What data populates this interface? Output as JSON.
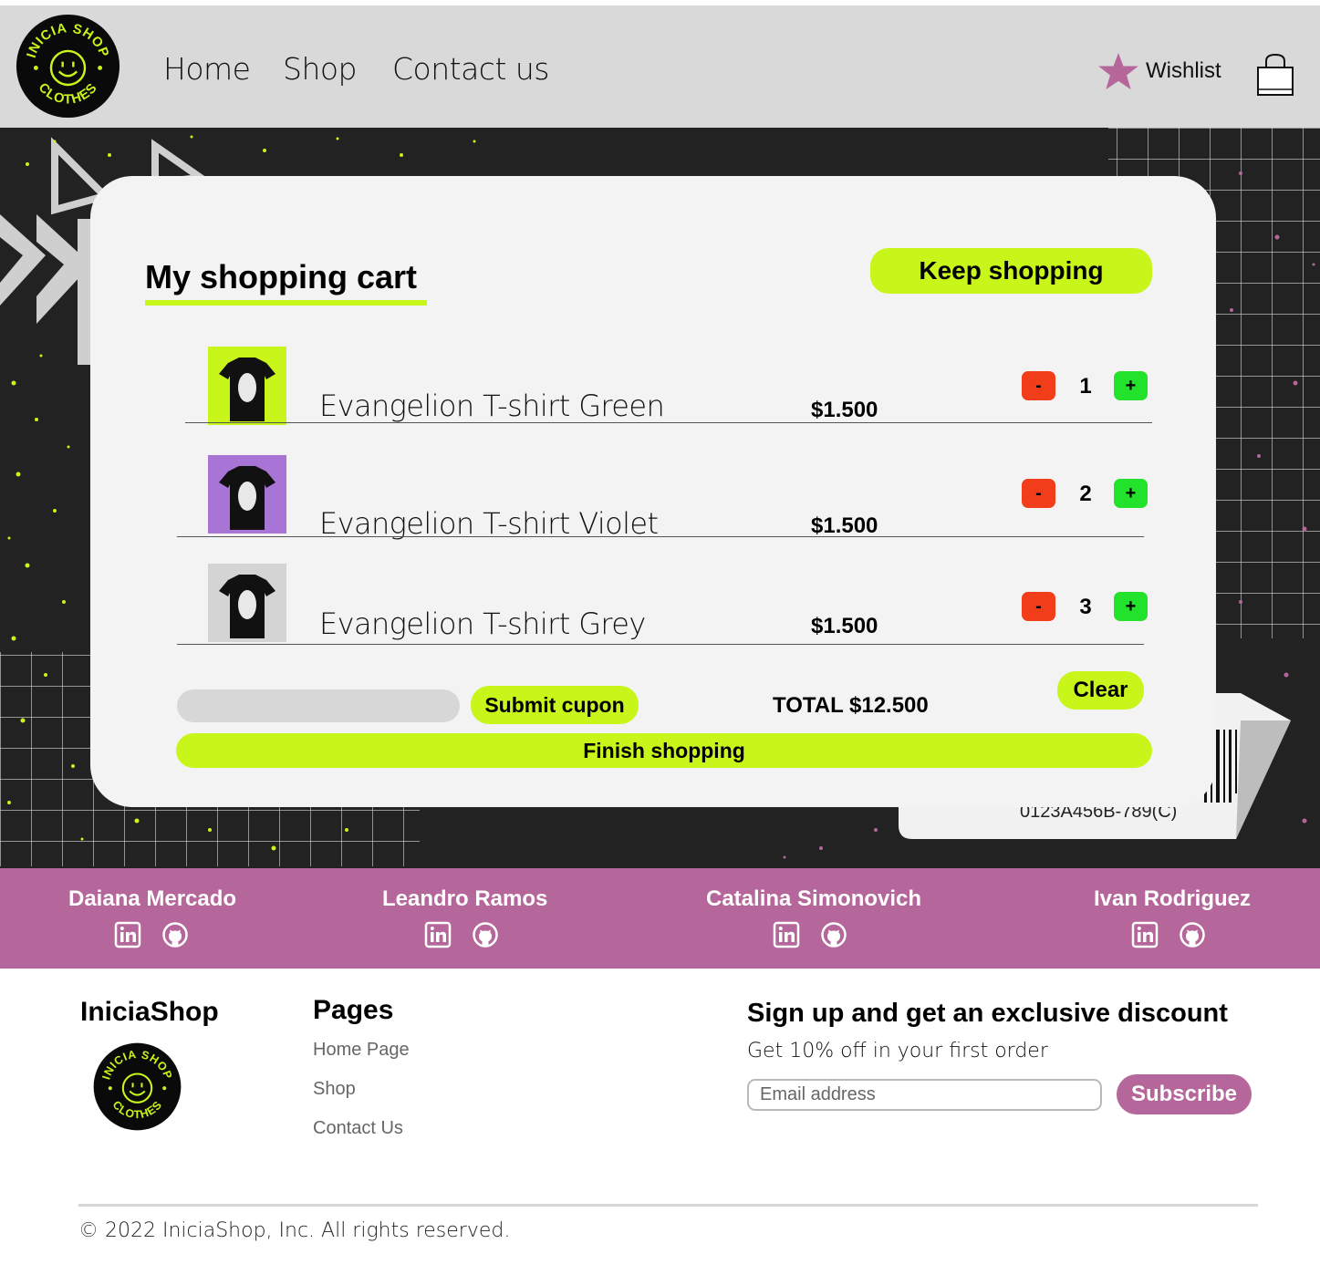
{
  "header": {
    "logo_top_text": "INICIA SHOP",
    "logo_bottom_text": "CLOTHES",
    "nav": [
      {
        "label": "Home"
      },
      {
        "label": "Shop"
      },
      {
        "label": "Contact us"
      }
    ],
    "wishlist_label": "Wishlist",
    "icons": {
      "wishlist": "star-icon",
      "cart": "shopping-bag-icon"
    }
  },
  "colors": {
    "accent": "#c8f51a",
    "brand": "#b5679b",
    "header_bg": "#d9d9d9",
    "minus": "#f23d1b",
    "plus": "#22e22c"
  },
  "cart": {
    "title": "My shopping cart",
    "keep_shopping_label": "Keep shopping",
    "items": [
      {
        "name": "Evangelion T-shirt Green",
        "price": "$1.500",
        "qty": "1",
        "thumb_color": "#c8f51a",
        "minus_label": "-",
        "plus_label": "+"
      },
      {
        "name": "Evangelion T-shirt Violet",
        "price": "$1.500",
        "qty": "2",
        "thumb_color": "#a874d6",
        "minus_label": "-",
        "plus_label": "+"
      },
      {
        "name": "Evangelion T-shirt Grey",
        "price": "$1.500",
        "qty": "3",
        "thumb_color": "#d4d4d4",
        "minus_label": "-",
        "plus_label": "+"
      }
    ],
    "coupon_placeholder": "",
    "submit_coupon_label": "Submit cupon",
    "total_label": "TOTAL $12.500",
    "clear_label": "Clear",
    "finish_label": "Finish shopping"
  },
  "sticker": {
    "code": "0123A456B-789(C)"
  },
  "team": [
    {
      "name": "Daiana Mercado"
    },
    {
      "name": "Leandro Ramos"
    },
    {
      "name": "Catalina Simonovich"
    },
    {
      "name": "Ivan Rodriguez"
    }
  ],
  "footer": {
    "brand": "IniciaShop",
    "pages_title": "Pages",
    "pages": [
      {
        "label": "Home Page"
      },
      {
        "label": "Shop"
      },
      {
        "label": "Contact Us"
      }
    ],
    "signup_title": "Sign up and get an exclusive discount",
    "signup_subtitle": "Get 10% off in your first order",
    "email_placeholder": "Email address",
    "subscribe_label": "Subscribe",
    "copyright": "© 2022 IniciaShop, Inc. All rights reserved."
  }
}
